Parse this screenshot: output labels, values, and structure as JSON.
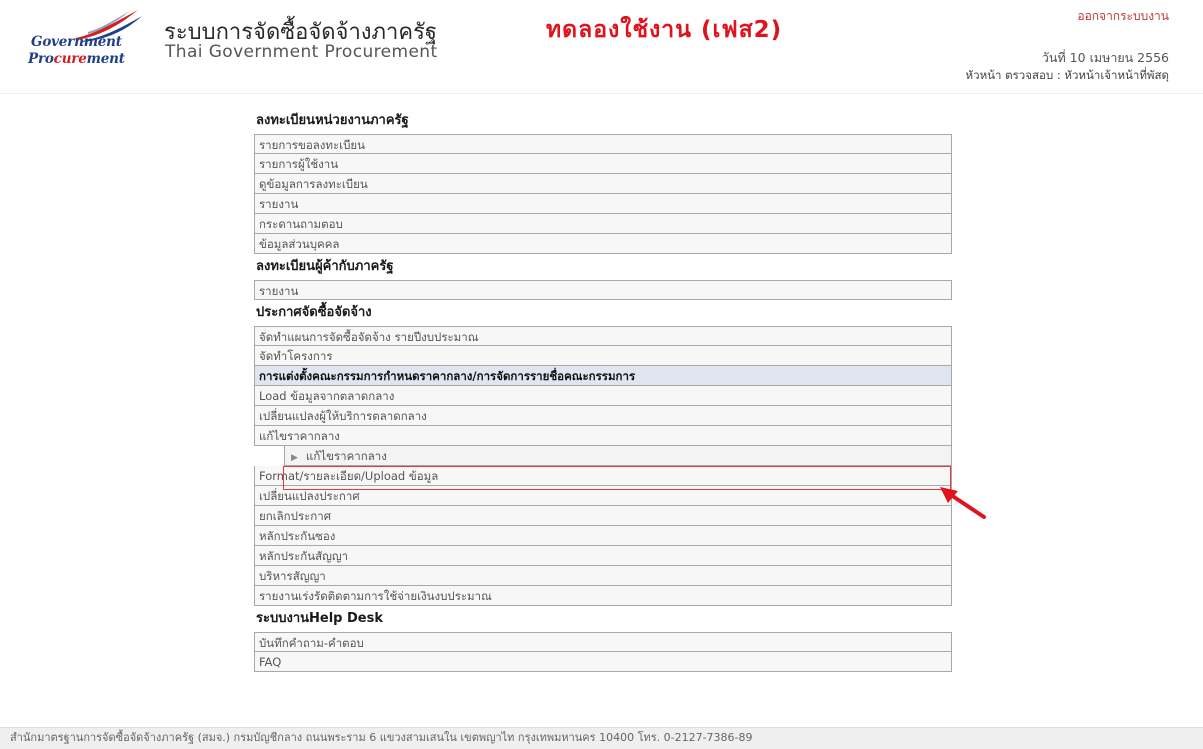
{
  "header": {
    "logo_word1": "Government",
    "logo_word2_pre": "Pro",
    "logo_word2_red": "cure",
    "logo_word2_post": "ment",
    "title_th": "ระบบการจัดซื้อจัดจ้างภาครัฐ",
    "title_demo": "ทดลองใช้งาน (เฟส2)",
    "title_en": "Thai Government Procurement",
    "logout_label": "ออกจากระบบงาน",
    "date_text": "วันที่ 10 เมษายน 2556",
    "role_text": "หัวหน้า ตรวจสอบ : หัวหน้าเจ้าหน้าที่พัสดุ"
  },
  "menu": {
    "sections": [
      {
        "title": "ลงทะเบียนหน่วยงานภาครัฐ",
        "items": [
          "รายการขอลงทะเบียน",
          "รายการผู้ใช้งาน",
          "ดูข้อมูลการลงทะเบียน",
          "รายงาน",
          "กระดานถามตอบ",
          "ข้อมูลส่วนบุคคล"
        ]
      },
      {
        "title": "ลงทะเบียนผู้ค้ากับภาครัฐ",
        "items": [
          "รายงาน"
        ]
      },
      {
        "title": "ประกาศจัดซื้อจัดจ้าง",
        "items": [
          "จัดทำแผนการจัดซื้อจัดจ้าง รายปีงบประมาณ",
          "จัดทำโครงการ",
          "การแต่งตั้งคณะกรรมการกำหนดราคากลาง/การจัดการรายชื่อคณะกรรมการ",
          "Load ข้อมูลจากตลาดกลาง",
          "เปลี่ยนแปลงผู้ให้บริการตลาดกลาง",
          "แก้ไขราคากลาง",
          "แก้ไขราคากลาง",
          "Format/รายละเอียด/Upload ข้อมูล",
          "เปลี่ยนแปลงประกาศ",
          "ยกเลิกประกาศ",
          "หลักประกันซอง",
          "หลักประกันสัญญา",
          "บริหารสัญญา",
          "รายงานเร่งรัดติดตามการใช้จ่ายเงินงบประมาณ"
        ]
      },
      {
        "title": "ระบบงานHelp Desk",
        "items": [
          "บันทึกคำถาม-คำตอบ",
          "FAQ"
        ]
      }
    ]
  },
  "footer": {
    "text": "สำนักมาตรฐานการจัดซื้อจัดจ้างภาครัฐ (สมจ.) กรมบัญชีกลาง ถนนพระราม 6 แขวงสามเสนใน เขตพญาไท กรุงเทพมหานคร 10400 โทร. 0-2127-7386-89"
  },
  "colors": {
    "brand_red": "#e0121c",
    "logo_blue": "#1f3f8a",
    "highlight_red": "#e43a3a"
  }
}
